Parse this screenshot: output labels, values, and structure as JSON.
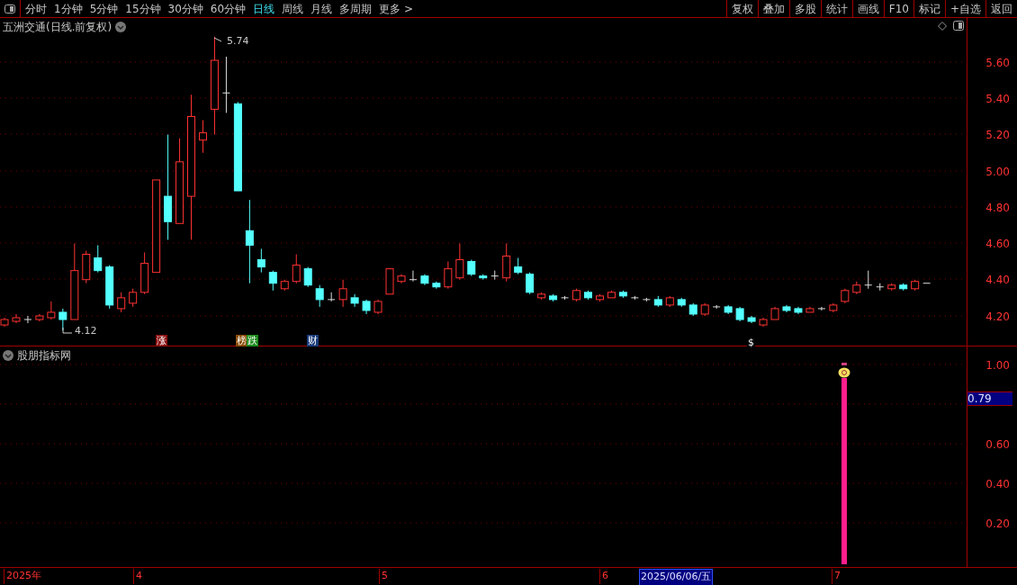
{
  "toolbar": {
    "periods": [
      {
        "label": "分时",
        "selected": false
      },
      {
        "label": "1分钟",
        "selected": false
      },
      {
        "label": "5分钟",
        "selected": false
      },
      {
        "label": "15分钟",
        "selected": false
      },
      {
        "label": "30分钟",
        "selected": false
      },
      {
        "label": "60分钟",
        "selected": false
      },
      {
        "label": "日线",
        "selected": true
      },
      {
        "label": "周线",
        "selected": false
      },
      {
        "label": "月线",
        "selected": false
      },
      {
        "label": "多周期",
        "selected": false
      },
      {
        "label": "更多 >",
        "selected": false
      }
    ],
    "buttons": [
      "复权",
      "叠加",
      "多股",
      "统计",
      "画线",
      "F10",
      "标记",
      "+自选",
      "返回"
    ]
  },
  "main_chart": {
    "title": "五洲交通(日线.前复权)",
    "y_labels": [
      "5.60",
      "5.40",
      "5.20",
      "5.00",
      "4.80",
      "4.60",
      "4.40",
      "4.20"
    ],
    "high_label": "5.74",
    "low_label": "4.12",
    "markers": [
      {
        "text": "涨",
        "color": "#8b1010"
      },
      {
        "text": "榜",
        "color": "#8a4a00"
      },
      {
        "text": "跌",
        "color": "#1a8a1a"
      },
      {
        "text": "财",
        "color": "#1a3a7a"
      },
      {
        "text": "$",
        "color": "#000000"
      }
    ]
  },
  "indicator": {
    "title": "股朋指标网",
    "y_labels": [
      "1.00",
      "0.60",
      "0.40",
      "0.20"
    ],
    "cursor_value": "0.79"
  },
  "date_axis": {
    "labels": [
      "2025年",
      "4",
      "5",
      "6",
      "7"
    ],
    "cursor_date": "2025/06/06/五"
  }
}
